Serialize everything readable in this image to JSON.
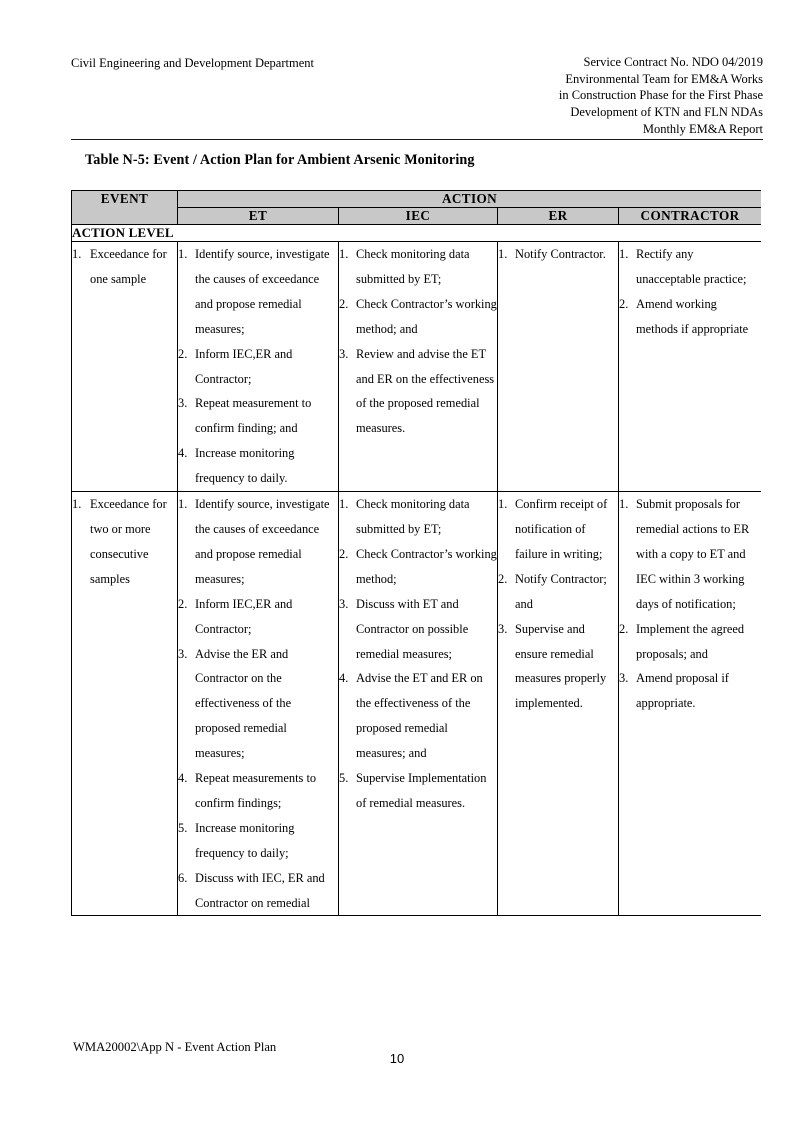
{
  "header": {
    "left": "Civil Engineering and Development Department",
    "right_lines": [
      "Service Contract No. NDO 04/2019",
      "Environmental Team for EM&A Works",
      "in Construction Phase for the First Phase",
      "Development of KTN and FLN NDAs",
      "Monthly EM&A Report"
    ]
  },
  "table": {
    "caption": "Table N-5: Event / Action Plan for Ambient Arsenic Monitoring",
    "header_gray": "#c8c8c8",
    "col_event": "EVENT",
    "col_action_group": "ACTION",
    "sub_headers": [
      "ET",
      "IEC",
      "ER",
      "CONTRACTOR"
    ],
    "section_label": "ACTION LEVEL",
    "rows": [
      {
        "event": [
          "Exceedance for one sample"
        ],
        "et": [
          "Identify source, investigate the causes of exceedance and propose remedial measures;",
          "Inform IEC,ER and Contractor;",
          "Repeat measurement to confirm finding; and",
          "Increase monitoring frequency to daily."
        ],
        "iec": [
          "Check monitoring data submitted by ET;",
          "Check Contractor’s working method; and",
          "Review and advise the ET and ER on the effectiveness of the proposed remedial measures."
        ],
        "er": [
          "Notify Contractor."
        ],
        "contractor": [
          "Rectify any unacceptable practice;",
          "Amend working methods if appropriate"
        ]
      },
      {
        "event": [
          "Exceedance for two or more consecutive samples"
        ],
        "et": [
          "Identify source, investigate the causes of exceedance and propose remedial measures;",
          "Inform IEC,ER and Contractor;",
          "Advise the ER and Contractor on the effectiveness of the proposed remedial measures;",
          "Repeat measurements to confirm findings;",
          "Increase monitoring frequency to daily;",
          "Discuss with IEC, ER and Contractor on remedial"
        ],
        "iec": [
          "Check monitoring data submitted by ET;",
          "Check Contractor’s working method;",
          "Discuss with ET and Contractor on possible remedial measures;",
          "Advise the ET and ER on the effectiveness of the proposed remedial measures; and",
          "Supervise Implementation of remedial measures."
        ],
        "er": [
          "Confirm receipt of notification of failure in writing;",
          "Notify Contractor; and",
          "Supervise and ensure remedial measures properly implemented."
        ],
        "contractor": [
          "Submit proposals for remedial actions to ER with a copy to ET and IEC within 3 working days of notification;",
          "Implement the agreed proposals; and",
          "Amend proposal if appropriate."
        ]
      }
    ]
  },
  "footer": {
    "left": "WMA20002\\App N - Event Action Plan",
    "page_number": "10"
  }
}
